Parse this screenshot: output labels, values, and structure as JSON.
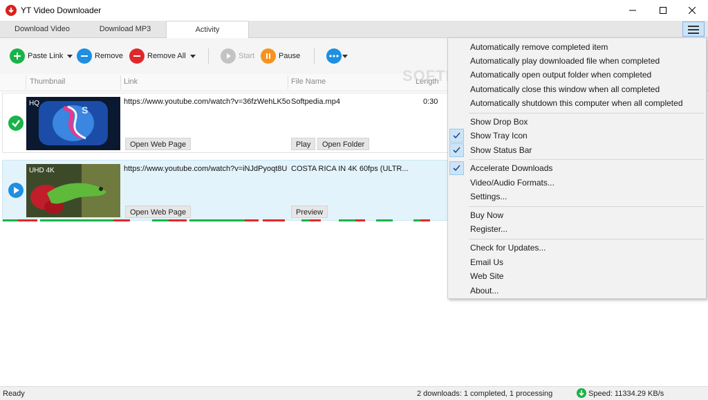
{
  "window": {
    "title": "YT Video Downloader"
  },
  "tabs": [
    {
      "label": "Download Video"
    },
    {
      "label": "Download MP3"
    },
    {
      "label": "Activity"
    }
  ],
  "toolbar": {
    "paste_link": "Paste Link",
    "remove": "Remove",
    "remove_all": "Remove All",
    "start": "Start",
    "pause": "Pause"
  },
  "columns": {
    "thumbnail": "Thumbnail",
    "link": "Link",
    "file_name": "File Name",
    "length": "Length"
  },
  "downloads": [
    {
      "status": "completed",
      "quality": "HQ",
      "link": "https://www.youtube.com/watch?v=36fzWehLK5o",
      "file_name": "Softpedia.mp4",
      "length": "0:30",
      "btn_open_web": "Open Web Page",
      "btn_play": "Play",
      "btn_open_folder": "Open Folder"
    },
    {
      "status": "processing",
      "quality": "UHD 4K",
      "link": "https://www.youtube.com/watch?v=iNJdPyoqt8U",
      "file_name": "COSTA RICA IN 4K 60fps (ULTR...",
      "length": "",
      "btn_open_web": "Open Web Page",
      "btn_preview": "Preview"
    }
  ],
  "menu": {
    "items": [
      {
        "label": "Automatically remove completed item",
        "checked": false
      },
      {
        "label": "Automatically play downloaded file when completed",
        "checked": false
      },
      {
        "label": "Automatically open output folder when completed",
        "checked": false
      },
      {
        "label": "Automatically close this window when all completed",
        "checked": false
      },
      {
        "label": "Automatically shutdown this computer when all completed",
        "checked": false
      },
      {
        "label": "Show Drop Box",
        "checked": false
      },
      {
        "label": "Show Tray Icon",
        "checked": true
      },
      {
        "label": "Show Status Bar",
        "checked": true
      },
      {
        "label": "Accelerate Downloads",
        "checked": true
      },
      {
        "label": "Video/Audio Formats...",
        "checked": false
      },
      {
        "label": "Settings...",
        "checked": false
      },
      {
        "label": "Buy Now",
        "checked": false
      },
      {
        "label": "Register...",
        "checked": false
      },
      {
        "label": "Check for Updates...",
        "checked": false
      },
      {
        "label": "Email Us",
        "checked": false
      },
      {
        "label": "Web Site",
        "checked": false
      },
      {
        "label": "About...",
        "checked": false
      }
    ]
  },
  "statusbar": {
    "left": "Ready",
    "summary": "2 downloads: 1 completed, 1 processing",
    "speed": "Speed: 11334.29 KB/s"
  },
  "watermark": "SOFTPEDIA",
  "colors": {
    "accent_green": "#19b34a",
    "accent_blue": "#1e8fe1",
    "accent_red": "#e0282a",
    "accent_orange": "#f7931d",
    "processing_row": "#e3f3fb",
    "brand_red": "#d9211c"
  },
  "icons": {
    "app": "download-arrow-icon",
    "paste": "plus-icon",
    "remove": "minus-icon",
    "remove_all": "minus-icon",
    "start": "play-icon",
    "pause": "pause-icon",
    "more": "ellipsis-icon",
    "menu": "hamburger-icon",
    "done": "checkmark-icon",
    "processing": "play-icon",
    "speed": "download-arrow-icon"
  }
}
